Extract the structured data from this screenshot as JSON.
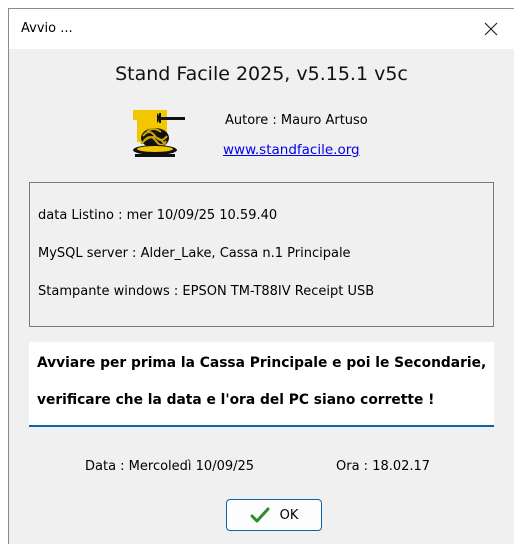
{
  "window": {
    "title": "Avvio ...",
    "close_icon": "close-icon"
  },
  "header": {
    "app_title": "Stand Facile 2025, v5.15.1 v5c",
    "author": "Autore : Mauro Artuso",
    "website": "www.standfacile.org",
    "logo_icon": "pasta-plate-icon"
  },
  "info": {
    "lines": [
      "data Listino : mer 10/09/25 10.59.40",
      "MySQL server : Alder_Lake, Cassa n.1 Principale",
      "Stampante windows : EPSON TM-T88IV Receipt USB"
    ]
  },
  "warning": {
    "lines": [
      "Avviare per prima la Cassa Principale e poi le Secondarie,",
      "verificare che la data e l'ora del PC siano corrette !"
    ]
  },
  "footer": {
    "date": "Data : Mercoledì  10/09/25",
    "time": "Ora : 18.02.17"
  },
  "ok_button": {
    "label": "OK",
    "icon": "checkmark-icon"
  },
  "colors": {
    "link": "#0000ee",
    "accent": "#0a64ad",
    "check": "#2e8b2e",
    "logo_yellow": "#f2c600"
  }
}
